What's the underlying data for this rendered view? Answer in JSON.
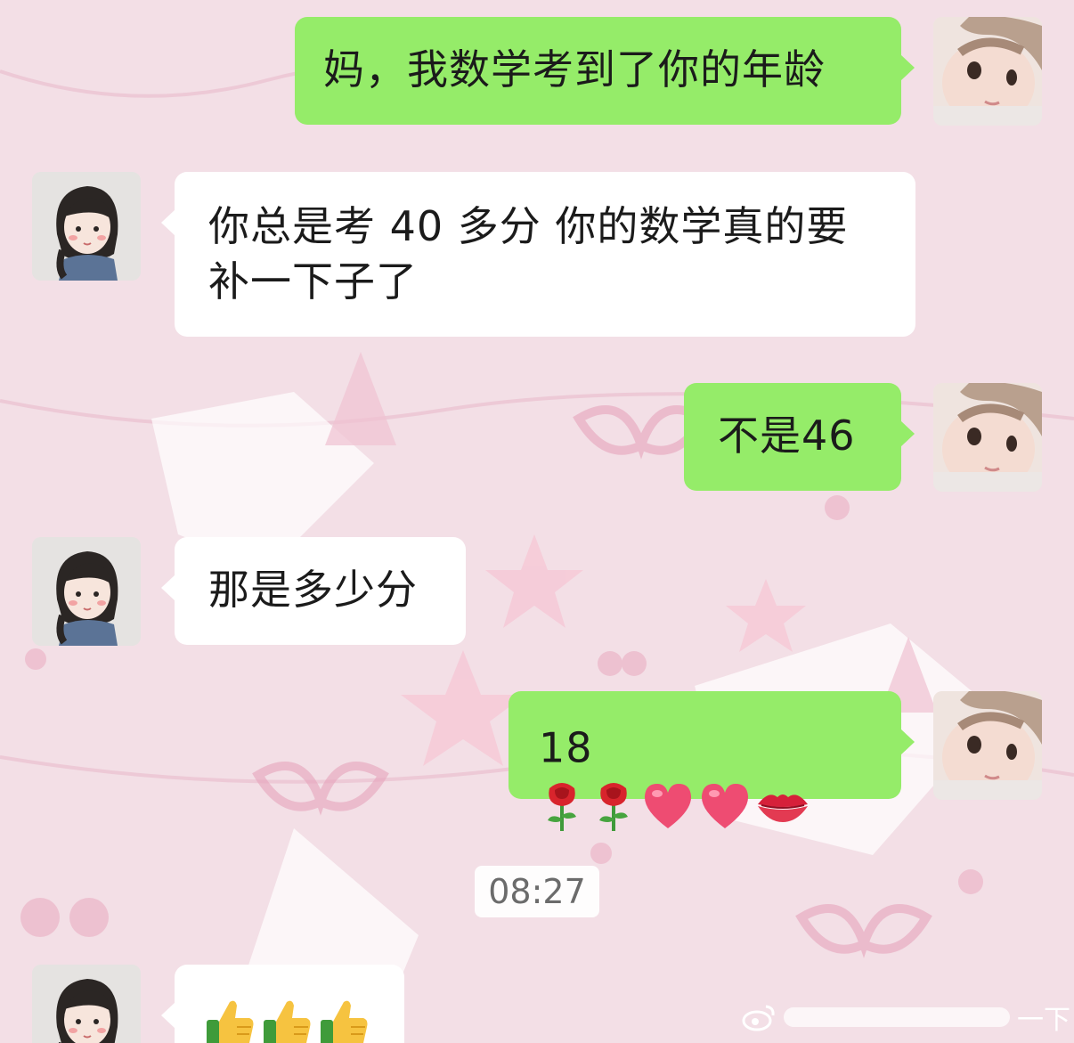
{
  "colors": {
    "wallpaper": "#f3dfe6",
    "sent_bubble": "#95ec69",
    "received_bubble": "#ffffff",
    "timestamp_text": "#6b6b6b"
  },
  "conversation": {
    "messages": [
      {
        "sender": "me",
        "avatar": "child-avatar",
        "text": "妈，我数学考到了你的年龄"
      },
      {
        "sender": "mom",
        "avatar": "mom-avatar",
        "lines": [
          "你总是考 40 多分  你的数学真的要",
          "补一下子了"
        ]
      },
      {
        "sender": "me",
        "avatar": "child-avatar",
        "text": "不是46"
      },
      {
        "sender": "mom",
        "avatar": "mom-avatar",
        "text": "那是多少分"
      },
      {
        "sender": "me",
        "avatar": "child-avatar",
        "text": "18",
        "emojis": [
          "rose-emoji",
          "rose-emoji",
          "heart-emoji",
          "heart-emoji",
          "lips-emoji"
        ]
      },
      {
        "sender": "mom",
        "avatar": "mom-avatar",
        "emojis": [
          "thumbs-up-emoji",
          "thumbs-up-emoji",
          "thumbs-up-emoji"
        ]
      }
    ],
    "timestamp": "08:27"
  },
  "watermark": {
    "text": "一下",
    "icon": "weibo-logo-icon"
  }
}
